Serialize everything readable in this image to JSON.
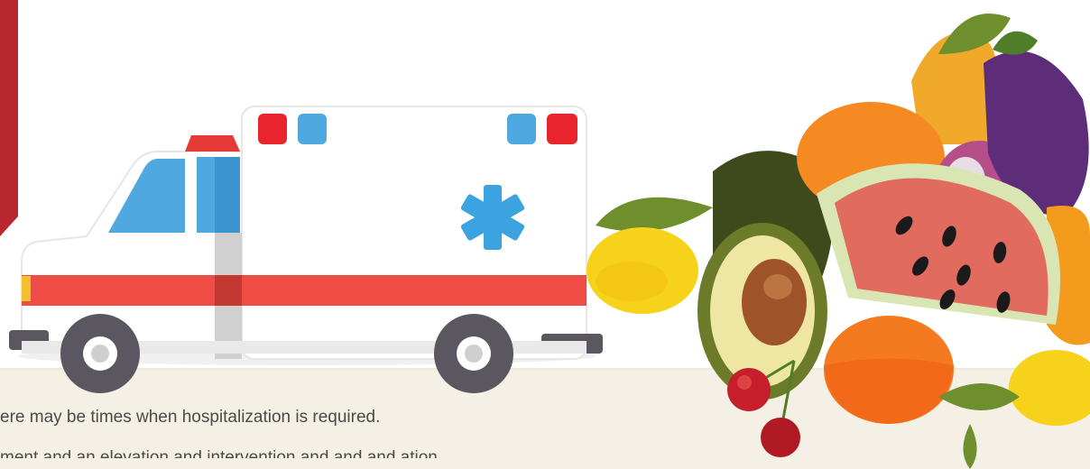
{
  "colors": {
    "accent_red": "#b8262f",
    "ambulance_stripe": "#ef4c45",
    "light_blue": "#4fa8e0",
    "band_background": "#f4f0e6"
  },
  "icons": [
    "ambulance-icon",
    "medical-star-icon",
    "fruit-vegetable-pile"
  ],
  "body_text": {
    "line1": "ere may be times when hospitalization is required.",
    "line2": "ment and an elevation and intervention and and and ation"
  }
}
